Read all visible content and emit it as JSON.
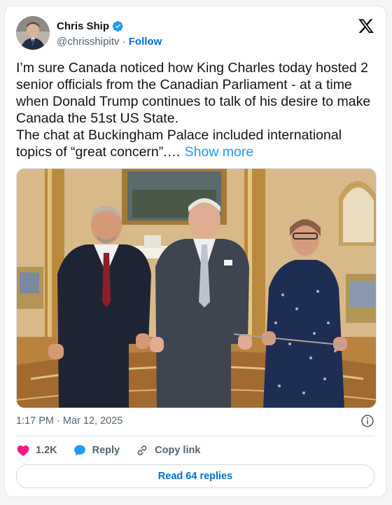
{
  "author": {
    "name": "Chris Ship",
    "handle": "@chrisshipitv",
    "separator": "·",
    "follow_label": "Follow"
  },
  "tweet": {
    "text": "I’m sure Canada noticed how King Charles today hosted 2 senior officials from the Canadian Parliament - at a time when Donald Trump continues to talk of his desire to make Canada the 51st US State.\nThe chat at Buckingham Palace included international topics of “great concern”.… ",
    "show_more": "Show more"
  },
  "meta": {
    "time": "1:17 PM",
    "separator": "·",
    "date": "Mar 12, 2025"
  },
  "actions": {
    "likes": "1.2K",
    "reply_label": "Reply",
    "copy_link_label": "Copy link"
  },
  "read_replies_label": "Read 64 replies",
  "colors": {
    "verified": "#1d9bf0",
    "heart": "#f91880",
    "link": "#006fd6"
  },
  "icons": [
    "verified-icon",
    "x-logo-icon",
    "info-icon",
    "heart-icon",
    "reply-icon",
    "link-icon"
  ]
}
